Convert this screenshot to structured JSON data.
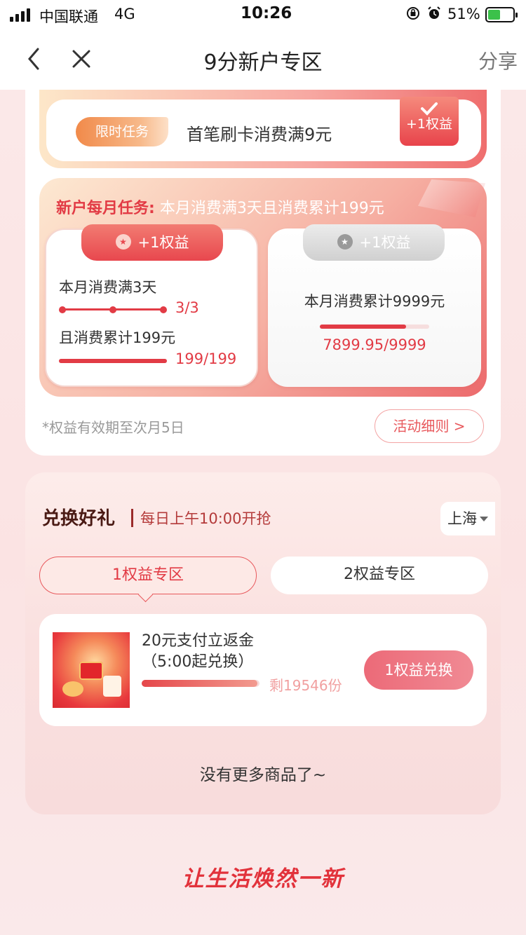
{
  "status_bar": {
    "carrier": "中国联通",
    "network": "4G",
    "time": "10:26",
    "battery_percent": "51%",
    "battery_level": 0.51
  },
  "nav": {
    "title": "9分新户专区",
    "share": "分享"
  },
  "first_task": {
    "tag": "限时任务",
    "text": "首笔刷卡消费满9元",
    "reward": "+1权益",
    "completed": true
  },
  "monthly_task": {
    "title_emphasis": "新户每月任务:",
    "title_rest": "本月消费满3天且消费累计199元",
    "left": {
      "reward": "+1权益",
      "label_a": "本月消费满3天",
      "progress_a": "3/3",
      "progress_a_fraction": 1.0,
      "label_b": "且消费累计199元",
      "progress_b": "199/199",
      "progress_b_fraction": 1.0
    },
    "right": {
      "reward": "+1权益",
      "label": "本月消费累计9999元",
      "progress": "7899.95/9999",
      "progress_fraction": 0.79
    },
    "validity_note": "*权益有效期至次月5日",
    "rules_button": "活动细则 >"
  },
  "exchange": {
    "title": "兑换好礼",
    "subtitle": "每日上午10:00开抢",
    "city": "上海",
    "tabs": [
      {
        "label": "1权益专区",
        "active": true
      },
      {
        "label": "2权益专区",
        "active": false
      }
    ],
    "products": [
      {
        "name": "20元支付立返金（5:00起兑换）",
        "stock_text": "剩19546份",
        "stock_fraction": 0.98,
        "button": "1权益兑换"
      }
    ],
    "no_more": "没有更多商品了~"
  },
  "slogan": "让生活焕然一新",
  "colors": {
    "accent_red": "#e23b45",
    "button_pink": "#ec6a78",
    "background_pink": "#fbe9e9"
  }
}
